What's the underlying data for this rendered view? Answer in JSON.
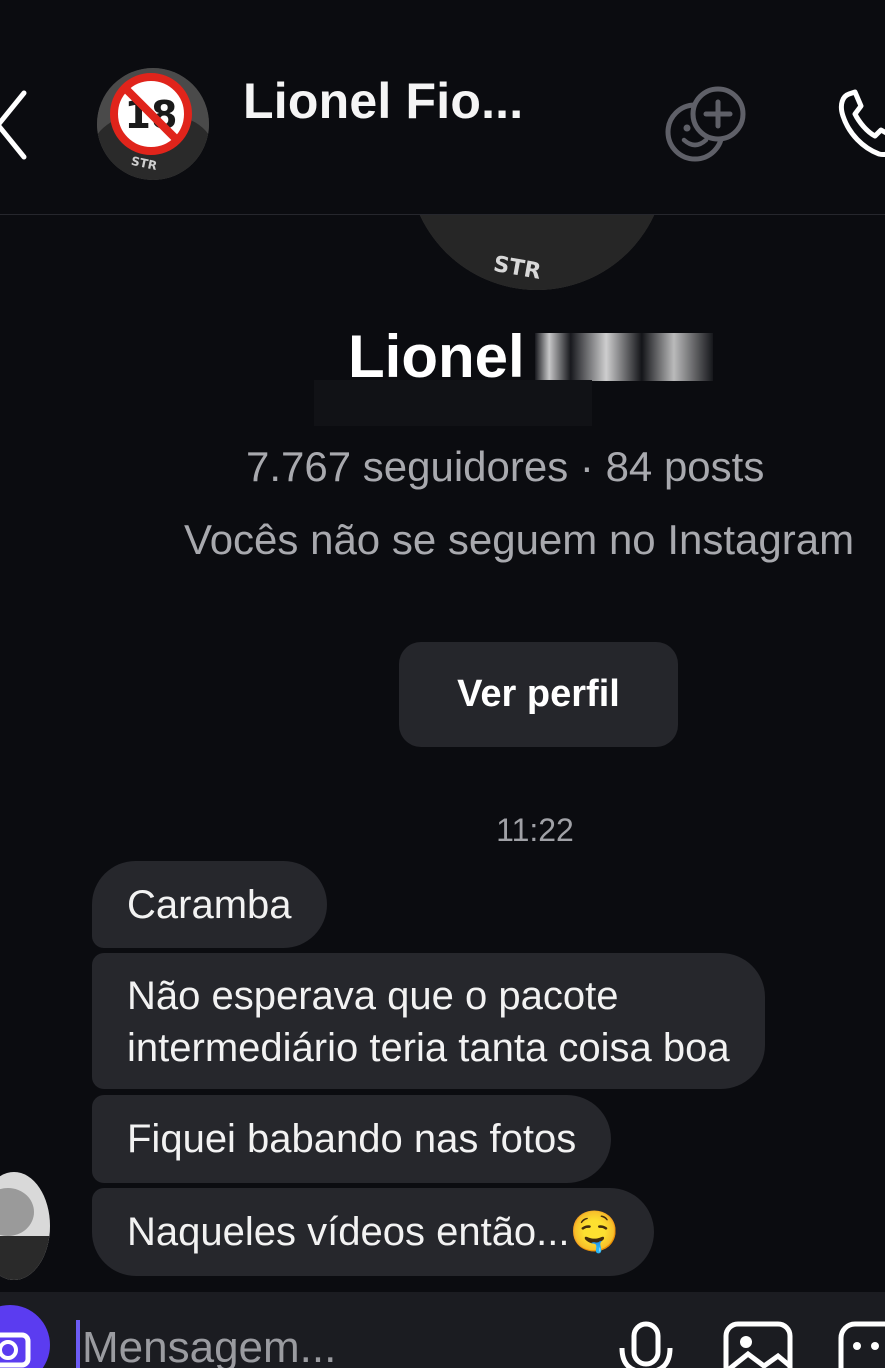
{
  "header": {
    "contact_name": "Lionel Fio...",
    "icons": {
      "back": "chevron-left-icon",
      "add_people": "group-add-icon",
      "call": "phone-icon"
    }
  },
  "profile": {
    "first_name": "Lionel",
    "stats": "7.767 seguidores · 84 posts",
    "follow_note": "Vocês não se seguem no Instagram",
    "view_profile_label": "Ver perfil"
  },
  "thread": {
    "timestamp": "11:22",
    "messages": [
      {
        "text": "Caramba"
      },
      {
        "lines": [
          "Não esperava que o pacote",
          "intermediário teria tanta coisa boa"
        ]
      },
      {
        "text": "Fiquei babando nas fotos"
      },
      {
        "text": "Naqueles vídeos então...🤤"
      }
    ]
  },
  "composer": {
    "placeholder": "Mensagem...",
    "icons": {
      "camera": "camera-icon",
      "mic": "microphone-icon",
      "gallery": "image-icon",
      "sticker": "sticker-icon"
    }
  },
  "colors": {
    "background": "#0b0c10",
    "bubble": "#26272c",
    "muted_text": "#a8a9ae",
    "accent": "#5b3cf0"
  }
}
